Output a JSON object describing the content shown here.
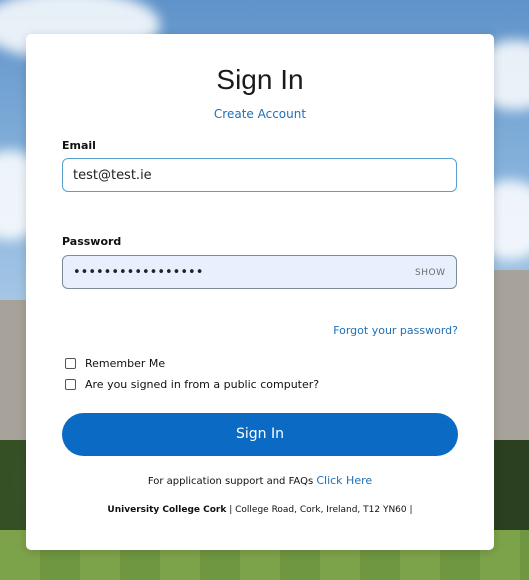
{
  "form": {
    "title": "Sign In",
    "create_account": "Create Account",
    "email_label": "Email",
    "email_value": "test@test.ie",
    "password_label": "Password",
    "password_value": "•••••••••••••••••",
    "show_label": "SHOW",
    "forgot_password": "Forgot your password?",
    "remember_me": "Remember Me",
    "public_computer": "Are you signed in from a public computer?",
    "signin_button": "Sign In",
    "support_text": "For application support and FAQs",
    "support_link": "Click Here"
  },
  "footer": {
    "org": "University College Cork",
    "address": "College Road, Cork, Ireland, T12 YN60"
  },
  "colors": {
    "accent": "#0a6ac4",
    "link": "#1f6fb5",
    "password_bg": "#e8f0fe"
  }
}
